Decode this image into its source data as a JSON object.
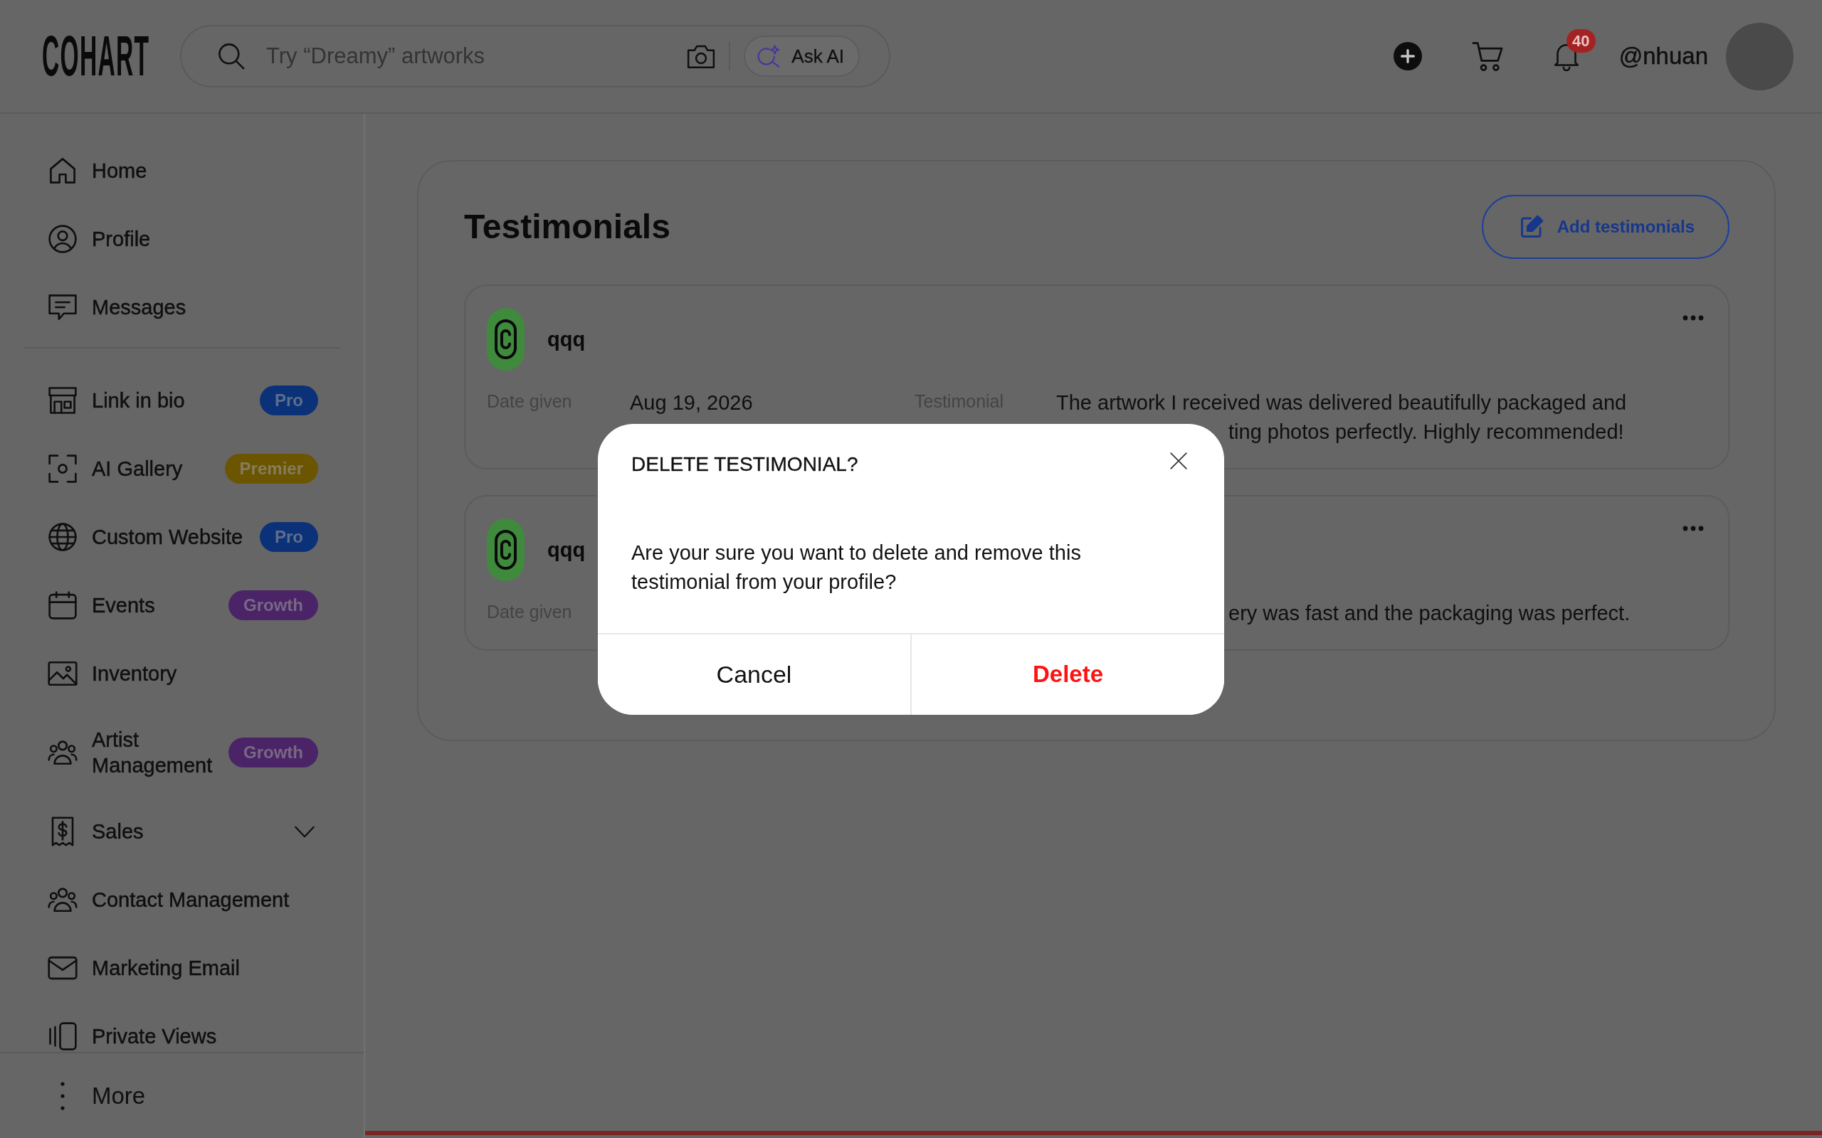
{
  "header": {
    "logo": "COHART",
    "search": {
      "placeholder": "Try “Dreamy” artworks"
    },
    "ask_ai": "Ask AI",
    "notification_count": "40",
    "username": "@nhuan"
  },
  "sidebar": {
    "sections": [
      {
        "items": [
          {
            "label": "Home",
            "selected": false
          },
          {
            "label": "Profile",
            "selected": false
          },
          {
            "label": "Messages",
            "selected": false
          }
        ]
      },
      {
        "items": [
          {
            "label": "Link in bio",
            "selected": false,
            "badge": {
              "label": "Pro",
              "color": "#0b3278"
            }
          },
          {
            "label": "AI Gallery",
            "selected": false,
            "badge": {
              "label": "Premier",
              "color": "#6c5500"
            }
          },
          {
            "label": "Custom Website",
            "selected": false,
            "badge": {
              "label": "Pro",
              "color": "#0b3278"
            }
          },
          {
            "label": "Events",
            "selected": false,
            "badge": {
              "label": "Growth",
              "color": "#4b2468"
            }
          },
          {
            "label": "Inventory",
            "selected": false
          },
          {
            "label": "Artist Management",
            "selected": false,
            "badge": {
              "label": "Growth",
              "color": "#4b2468"
            }
          },
          {
            "label": "Sales",
            "selected": false,
            "expanded": false
          },
          {
            "label": "Contact Management",
            "selected": false
          },
          {
            "label": "Marketing Email",
            "selected": false
          },
          {
            "label": "Private Views",
            "selected": false
          }
        ]
      }
    ],
    "more": "More"
  },
  "testimonials": {
    "title": "Testimonials",
    "add_button": "Add testimonials",
    "items": [
      {
        "name": "qqq",
        "date_label": "Date given",
        "date": "Aug 19, 2026",
        "text_label": "Testimonial",
        "text_lines": [
          "The artwork I received was delivered beautifully packaged and",
          "ting photos perfectly. Highly recommended!"
        ]
      },
      {
        "name": "qqq",
        "date_label": "Date given",
        "text_lines": [
          "ery was fast and the packaging was perfect."
        ]
      }
    ]
  },
  "dialog": {
    "title": "DELETE TESTIMONIAL?",
    "message": "Are your sure you want to delete and remove this testimonial from your profile?",
    "buttons": [
      {
        "label": "Cancel",
        "kind": "cancel"
      },
      {
        "label": "Delete",
        "kind": "danger"
      }
    ]
  }
}
